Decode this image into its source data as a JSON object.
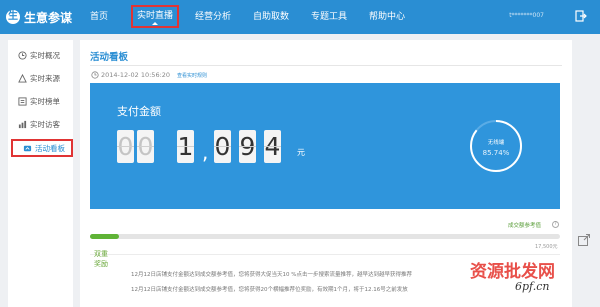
{
  "app": {
    "logo_mark": "生",
    "logo_text": "生意参谋"
  },
  "nav": {
    "items": [
      "首页",
      "实时直播",
      "经营分析",
      "自助取数",
      "专题工具",
      "帮助中心"
    ],
    "active": "实时直播"
  },
  "user": {
    "name": "t*******007"
  },
  "sidebar": {
    "items": [
      {
        "label": "实时概况",
        "icon": "clock-icon"
      },
      {
        "label": "实时来源",
        "icon": "source-icon"
      },
      {
        "label": "实时榜单",
        "icon": "ranking-icon"
      },
      {
        "label": "实时访客",
        "icon": "visitor-icon"
      },
      {
        "label": "活动看板",
        "icon": "dashboard-icon"
      }
    ],
    "active": "活动看板"
  },
  "main": {
    "title": "活动看板",
    "timestamp": "2014-12-02 10:56:20",
    "timestamp_link": "查看实时规则",
    "panel": {
      "label": "支付金额",
      "digits": [
        "0",
        "0",
        "1",
        "0",
        "9",
        "4"
      ],
      "unit": "元",
      "ring_label": "无线端",
      "ring_value": "85.74%",
      "ring_percent": 85.74
    },
    "target": {
      "label": "成交额参考值",
      "tip": "?",
      "end_value": "17,500元",
      "progress": 0.0625
    },
    "notice": {
      "title": "双重奖励",
      "lines": [
        "12月12日店铺支付金额达到成交额参考值，您将获得大促当天10 %点击一步搜索流量推荐，越早达到越早获得推荐",
        "12月12日店铺支付金额达到成交额参考值，您将获得20个横幅推荐位奖励，有效期1个月，将于12.16号之前发放"
      ]
    }
  },
  "watermark": {
    "text": "资源批发网",
    "url": "6pf.cn"
  },
  "colors": {
    "brand": "#2a8ed3",
    "panel": "#2f95dc",
    "progress": "#5fb336",
    "highlight": "#e03434"
  }
}
